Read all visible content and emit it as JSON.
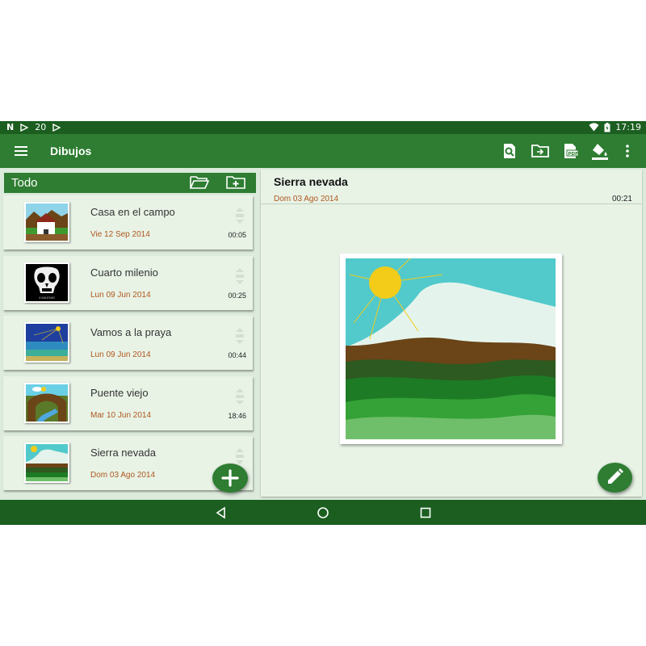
{
  "status_bar": {
    "notification_count": "20",
    "time": "17:19",
    "icons": [
      "n-icon",
      "play-store-icon",
      "play-store-icon",
      "wifi-icon",
      "battery-icon"
    ]
  },
  "app_bar": {
    "title": "Dibujos",
    "icons": [
      "menu-icon",
      "search-icon",
      "folder-move-icon",
      "pdf-icon",
      "paint-bucket-icon",
      "more-vert-icon"
    ]
  },
  "left_panel": {
    "header_label": "Todo",
    "header_icons": [
      "folder-open-icon",
      "folder-add-icon"
    ]
  },
  "drawings": [
    {
      "title": "Casa en el campo",
      "date": "Vie 12 Sep 2014",
      "duration": "00:05",
      "thumb": "house"
    },
    {
      "title": "Cuarto milenio",
      "date": "Lun 09 Jun 2014",
      "duration": "00:25",
      "thumb": "skull",
      "thumb_caption": "4 MILENIO"
    },
    {
      "title": "Vamos a la praya",
      "date": "Lun 09 Jun 2014",
      "duration": "00:44",
      "thumb": "beach"
    },
    {
      "title": "Puente viejo",
      "date": "Mar 10 Jun 2014",
      "duration": "18:46",
      "thumb": "bridge"
    },
    {
      "title": "Sierra nevada",
      "date": "Dom 03 Ago 2014",
      "duration": "",
      "thumb": "mountain"
    }
  ],
  "detail": {
    "title": "Sierra nevada",
    "date": "Dom 03 Ago 2014",
    "duration": "00:21"
  },
  "fabs": {
    "add": "plus-icon",
    "edit": "pencil-icon"
  },
  "nav_bar": [
    "back-icon",
    "home-icon",
    "recents-icon"
  ],
  "colors": {
    "primary": "#2e7d32",
    "primary_dark": "#1b5e20",
    "background": "#dcebdc",
    "card": "#e8f3e6",
    "date_text": "#b0571f"
  }
}
